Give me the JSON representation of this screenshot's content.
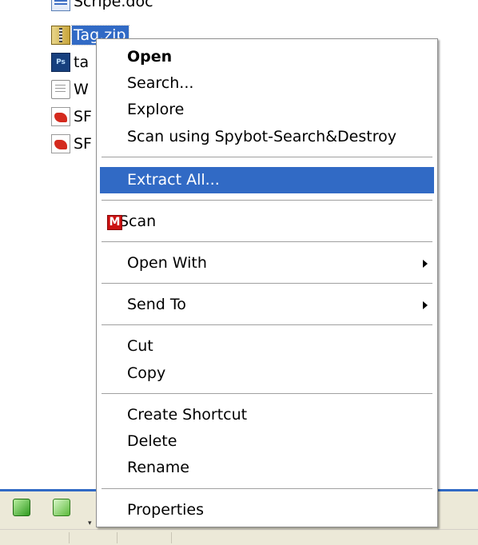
{
  "files": [
    {
      "name": "Scripe.doc",
      "icon": "word-doc-icon"
    },
    {
      "name": "Tag.zip",
      "icon": "zip-folder-icon",
      "selected": true
    },
    {
      "name": "ta",
      "icon": "photoshop-file-icon"
    },
    {
      "name": "W",
      "icon": "text-file-icon"
    },
    {
      "name": "SF",
      "icon": "pdf-file-icon"
    },
    {
      "name": "SF",
      "icon": "pdf-file-icon"
    }
  ],
  "context_menu": {
    "open": "Open",
    "search": "Search...",
    "explore": "Explore",
    "scan_spybot": "Scan using Spybot-Search&Destroy",
    "extract_all": "Extract All...",
    "scan": "Scan",
    "scan_icon_letter": "M",
    "open_with": "Open With",
    "send_to": "Send To",
    "cut": "Cut",
    "copy": "Copy",
    "create_shortcut": "Create Shortcut",
    "delete": "Delete",
    "rename": "Rename",
    "properties": "Properties"
  },
  "colors": {
    "highlight": "#316ac5",
    "menu_background": "#ffffff",
    "taskbar_background": "#ece9d8",
    "scan_icon": "#cc1111"
  },
  "taskbar": {
    "icons": [
      "green-square-icon",
      "green-cube-icon",
      "dropdown-arrow-icon"
    ]
  }
}
